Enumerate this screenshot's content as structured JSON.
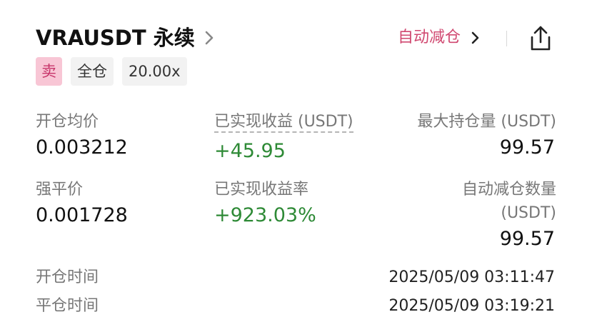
{
  "header": {
    "title": "VRAUSDT 永续",
    "auto_deleverage_label": "自动减仓"
  },
  "tags": [
    {
      "label": "卖"
    },
    {
      "label": "全仓"
    },
    {
      "label": "20.00x"
    }
  ],
  "metrics": {
    "entry_price": {
      "label": "开仓均价",
      "value": "0.003212"
    },
    "realized_pnl": {
      "label": "已实现收益 (USDT)",
      "value": "+45.95"
    },
    "max_position": {
      "label": "最大持仓量 (USDT)",
      "value": "99.57"
    },
    "liquidation_price": {
      "label": "强平价",
      "value": "0.001728"
    },
    "realized_pnl_rate": {
      "label": "已实现收益率",
      "value": "+923.03%"
    },
    "adl_quantity": {
      "label_line1": "自动减仓数量",
      "label_line2": "(USDT)",
      "value": "99.57"
    }
  },
  "times": {
    "open": {
      "label": "开仓时间",
      "value": "2025/05/09 03:11:47"
    },
    "close": {
      "label": "平仓时间",
      "value": "2025/05/09 03:19:21"
    }
  },
  "colors": {
    "accent_pink": "#d04870",
    "sell_tag_bg": "#f8c6d5",
    "positive_green": "#2e8a36"
  },
  "icons": {
    "title_chevron": "chevron-right-icon",
    "adl_chevron": "chevron-right-icon",
    "share": "share-icon"
  }
}
